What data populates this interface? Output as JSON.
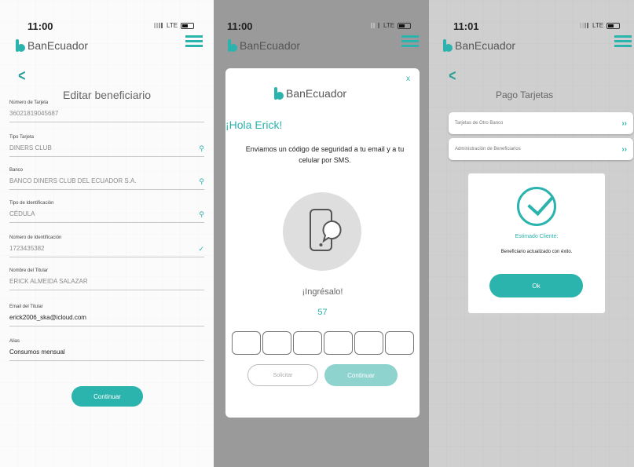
{
  "screens": [
    {
      "time": "11:00",
      "network": "LTE",
      "brand": "BanEcuador",
      "title": "Editar beneficiario",
      "fields": [
        {
          "label": "Número de Tarjeta",
          "value": "36021819045687"
        },
        {
          "label": "Tipo Tarjeta",
          "value": "DINERS CLUB"
        },
        {
          "label": "Banco",
          "value": "BANCO DINERS CLUB DEL ECUADOR S.A."
        },
        {
          "label": "Tipo de Identificación",
          "value": "CÉDULA"
        },
        {
          "label": "Número de Identificación",
          "value": "1723435382"
        },
        {
          "label": "Nombre del Titular",
          "value": "ERICK ALMEIDA SALAZAR"
        },
        {
          "label": "Email del Titular",
          "value": "erick2006_ska@icloud.com"
        },
        {
          "label": "Alias",
          "value": "Consumos mensual"
        }
      ],
      "continue_label": "Continuar"
    },
    {
      "time": "11:00",
      "network": "LTE",
      "brand": "BanEcuador",
      "close": "x",
      "greeting": "¡Hola Erick!",
      "message": "Enviamos un código de seguridad a tu email y a tu celular por SMS.",
      "prompt": "¡Ingrésalo!",
      "countdown": "57",
      "request_label": "Solicitar",
      "continue_label": "Continuar"
    },
    {
      "time": "11:01",
      "network": "LTE",
      "brand": "BanEcuador",
      "title": "Pago Tarjetas",
      "options": [
        {
          "label": "Tarjetas de Otro Banco"
        },
        {
          "label": "Administración de Beneficiarios"
        }
      ],
      "dialog_title": "Estimado Cliente:",
      "dialog_message": "Beneficiario actualizado con éxito.",
      "ok_label": "Ok"
    }
  ],
  "colors": {
    "accent": "#2bb3ad"
  }
}
